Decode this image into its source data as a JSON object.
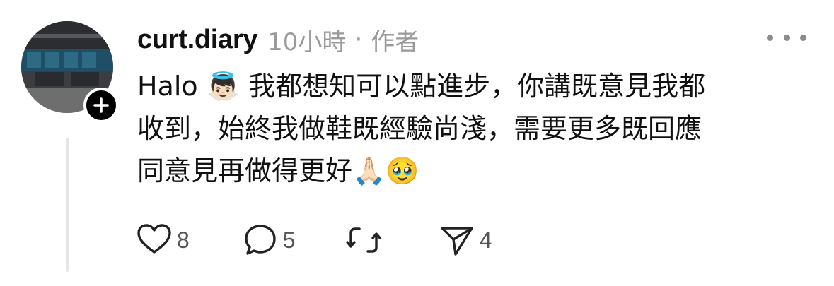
{
  "comment": {
    "username": "curt.diary",
    "time": "10小時",
    "separator": "·",
    "role": "作者",
    "lines": [
      {
        "text_before_emoji": "Halo ",
        "emoji": "👼🏻",
        "text_after_emoji": " 我都想知可以點進步，你講既意見我都"
      },
      {
        "text": "收到，始終我做鞋既經驗尚淺，需要更多既回應"
      },
      {
        "text": "同意見再做得更好",
        "emojis": "🙏🏻🥹"
      }
    ]
  },
  "actions": {
    "like_count": "8",
    "reply_count": "5",
    "repost_count": "",
    "share_count": "4"
  },
  "icons": {
    "follow": "plus-icon",
    "more": "more-horizontal-icon",
    "like": "heart-icon",
    "reply": "comment-bubble-icon",
    "repost": "repost-icon",
    "share": "send-icon"
  }
}
